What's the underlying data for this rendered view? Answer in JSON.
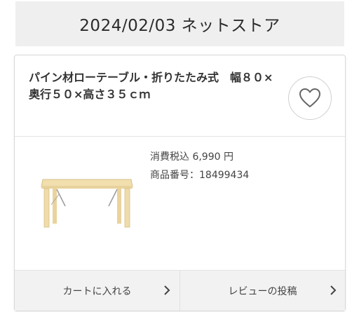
{
  "header": {
    "title": "2024/02/03  ネットストア"
  },
  "product": {
    "name": "パイン材ローテーブル・折りたたみ式　幅８０×奥行５０×高さ３５ｃｍ",
    "price_label": "消費税込",
    "price": "6,990",
    "currency": "円",
    "sku_label": "商品番号：",
    "sku": "18499434"
  },
  "actions": {
    "favorite_icon": "heart-icon",
    "cart_label": "カートに入れる",
    "review_label": "レビューの投稿",
    "chevron_icon": "chevron-right-icon"
  },
  "colors": {
    "header_bg": "#efefef",
    "button_bg": "#f2f2f2",
    "text": "#333333"
  }
}
